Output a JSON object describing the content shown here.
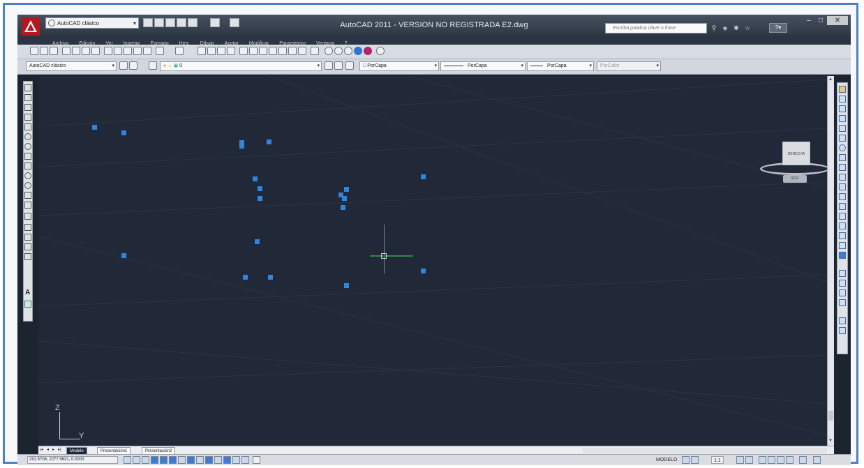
{
  "window": {
    "title": "AutoCAD 2011 - VERSION NO REGISTRADA     E2.dwg",
    "workspace": "AutoCAD clásico",
    "search_placeholder": "Escriba palabra clave o frase",
    "controls": [
      "–",
      "□",
      "✕"
    ]
  },
  "menubar": [
    "Archivo",
    "Edición",
    "Ver",
    "Insertar",
    "Formato",
    "Herr.",
    "Dibujo",
    "Acotar",
    "Modificar",
    "Parametrico",
    "Ventana",
    "?"
  ],
  "toolbar2": {
    "workspace": "AutoCAD clásico",
    "layer": "0",
    "color": "PorCapa",
    "linetype": "PorCapa",
    "lineweight": "PorCapa",
    "plotstyle": "PorColor"
  },
  "viewcube": {
    "face": "DERECHA",
    "wcs": "SCU"
  },
  "ucs": {
    "z": "Z",
    "y": "Y"
  },
  "tabs": [
    "Modelo",
    "Presentación1",
    "Presentación2"
  ],
  "status": {
    "coords": "291.5706, 2277.9631, 0.0000",
    "model": "MODELO",
    "scale": "1:1"
  },
  "colors": {
    "viewport_bg": "#212837",
    "point": "#2e86de",
    "accent": "#4f7fc7"
  }
}
